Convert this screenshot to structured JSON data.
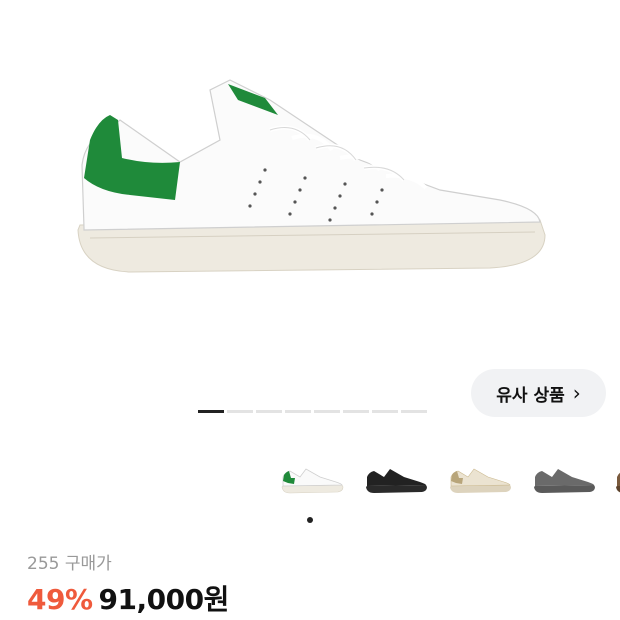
{
  "similar_products": {
    "label": "유사 상품",
    "icon": "chevron-right-icon"
  },
  "gallery": {
    "total_images": 8,
    "active_index": 1
  },
  "color_options": [
    {
      "color": "#ffffff",
      "accent": "#1f8a3a"
    },
    {
      "color": "#222222",
      "accent": "#111111"
    },
    {
      "color": "#e9e1cf",
      "accent": "#cbb98f"
    },
    {
      "color": "#6a6a6a",
      "accent": "#555555"
    },
    {
      "color": "#7a5a3d",
      "accent": "#5d432c"
    }
  ],
  "product": {
    "review_count": "255",
    "purchase_label": "구매가",
    "discount": "49%",
    "price": "91,000원"
  },
  "colors": {
    "accent_discount": "#ef5a3c",
    "shoe_green": "#1f8a3a",
    "sole": "#eeeae0"
  }
}
